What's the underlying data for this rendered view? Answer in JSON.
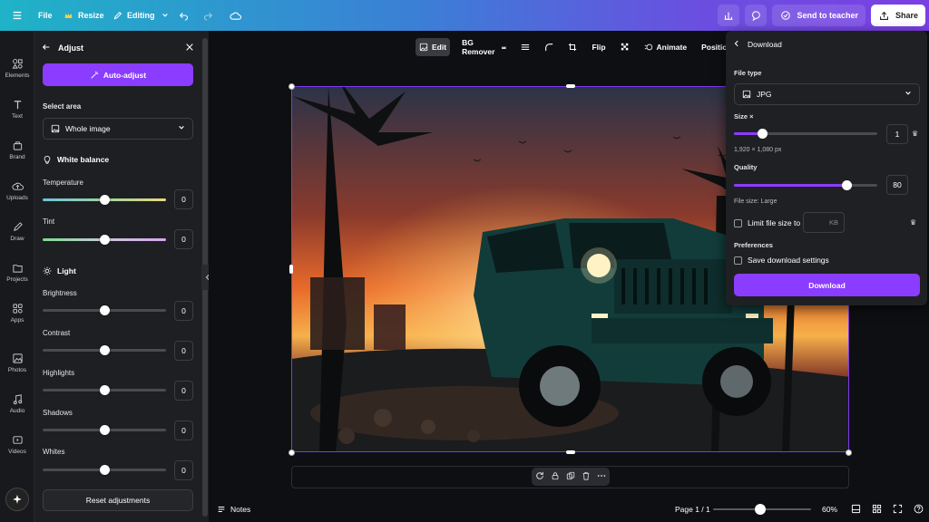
{
  "topbar": {
    "file_label": "File",
    "resize_label": "Resize",
    "editing_label": "Editing",
    "send_label": "Send to teacher",
    "share_label": "Share"
  },
  "rail": {
    "items": [
      {
        "label": "Elements",
        "icon": "elements-icon"
      },
      {
        "label": "Text",
        "icon": "text-icon"
      },
      {
        "label": "Brand",
        "icon": "brand-icon"
      },
      {
        "label": "Uploads",
        "icon": "uploads-icon"
      },
      {
        "label": "Draw",
        "icon": "draw-icon"
      },
      {
        "label": "Projects",
        "icon": "folder-icon"
      },
      {
        "label": "Apps",
        "icon": "apps-icon"
      },
      {
        "label": "Photos",
        "icon": "photos-icon"
      },
      {
        "label": "Audio",
        "icon": "audio-icon"
      },
      {
        "label": "Videos",
        "icon": "videos-icon"
      }
    ]
  },
  "adjust": {
    "title": "Adjust",
    "auto_adjust": "Auto-adjust",
    "select_area_label": "Select area",
    "select_area_value": "Whole image",
    "white_balance_label": "White balance",
    "light_label": "Light",
    "reset_label": "Reset adjustments",
    "sliders": [
      {
        "label": "Temperature",
        "value": "0",
        "level": 0.5,
        "kind": "temperature"
      },
      {
        "label": "Tint",
        "value": "0",
        "level": 0.5,
        "kind": "tint"
      },
      {
        "label": "Brightness",
        "value": "0",
        "level": 0.5,
        "kind": "plain"
      },
      {
        "label": "Contrast",
        "value": "0",
        "level": 0.5,
        "kind": "plain"
      },
      {
        "label": "Highlights",
        "value": "0",
        "level": 0.5,
        "kind": "plain"
      },
      {
        "label": "Shadows",
        "value": "0",
        "level": 0.5,
        "kind": "plain"
      },
      {
        "label": "Whites",
        "value": "0",
        "level": 0.5,
        "kind": "plain"
      }
    ]
  },
  "context_toolbar": {
    "edit": "Edit",
    "bg_remover": "BG Remover",
    "flip": "Flip",
    "animate": "Animate",
    "position": "Position"
  },
  "bottombar": {
    "notes": "Notes",
    "page": "Page 1 / 1",
    "zoom": "60%",
    "zoom_level": 0.48
  },
  "download": {
    "title": "Download",
    "file_type_label": "File type",
    "file_type_value": "JPG",
    "size_label": "Size ×",
    "size_value": "1",
    "size_level": 0.2,
    "dimensions": "1,920 × 1,080 px",
    "quality_label": "Quality",
    "quality_value": "80",
    "quality_level": 0.79,
    "file_size": "File size: Large",
    "limit_label": "Limit file size to",
    "kb_unit": "KB",
    "preferences_label": "Preferences",
    "save_settings_label": "Save download settings",
    "button": "Download"
  },
  "colors": {
    "accent": "#8b3dff",
    "panel": "#1e1f22",
    "canvas_bg": "#0e0f12"
  }
}
